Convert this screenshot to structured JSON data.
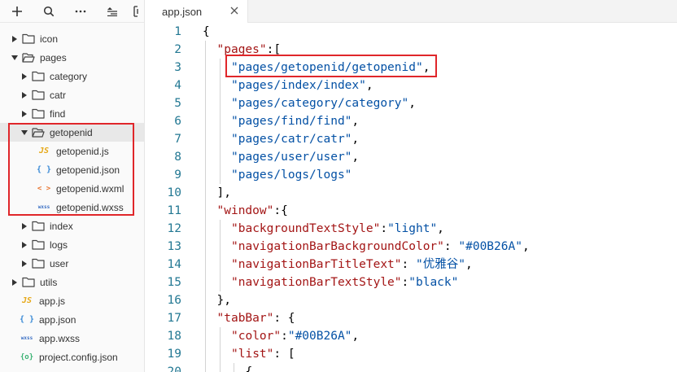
{
  "toolbar": {
    "buttons": [
      {
        "name": "add-icon"
      },
      {
        "name": "search-icon"
      },
      {
        "name": "more-icon"
      },
      {
        "name": "collapse-all-icon"
      },
      {
        "name": "split-icon"
      }
    ]
  },
  "tree": [
    {
      "label": "icon",
      "type": "folder",
      "depth": 0,
      "expanded": false
    },
    {
      "label": "pages",
      "type": "folder",
      "depth": 0,
      "expanded": true
    },
    {
      "label": "category",
      "type": "folder",
      "depth": 1,
      "expanded": false
    },
    {
      "label": "catr",
      "type": "folder",
      "depth": 1,
      "expanded": false
    },
    {
      "label": "find",
      "type": "folder",
      "depth": 1,
      "expanded": false
    },
    {
      "label": "getopenid",
      "type": "folder",
      "depth": 1,
      "expanded": true,
      "selected": true
    },
    {
      "label": "getopenid.js",
      "type": "js",
      "depth": 2
    },
    {
      "label": "getopenid.json",
      "type": "json",
      "depth": 2
    },
    {
      "label": "getopenid.wxml",
      "type": "wxml",
      "depth": 2
    },
    {
      "label": "getopenid.wxss",
      "type": "wxss",
      "depth": 2
    },
    {
      "label": "index",
      "type": "folder",
      "depth": 1,
      "expanded": false
    },
    {
      "label": "logs",
      "type": "folder",
      "depth": 1,
      "expanded": false
    },
    {
      "label": "user",
      "type": "folder",
      "depth": 1,
      "expanded": false
    },
    {
      "label": "utils",
      "type": "folder",
      "depth": 0,
      "expanded": false
    },
    {
      "label": "app.js",
      "type": "js",
      "depth": 0
    },
    {
      "label": "app.json",
      "type": "json",
      "depth": 0
    },
    {
      "label": "app.wxss",
      "type": "wxss",
      "depth": 0
    },
    {
      "label": "project.config.json",
      "type": "config",
      "depth": 0
    }
  ],
  "file_icons": {
    "js": "JS",
    "json": "{ }",
    "wxml": "< >",
    "wxss": "wxss",
    "config": "{o}"
  },
  "editor": {
    "tab_label": "app.json",
    "lines": [
      {
        "n": "1",
        "indent": 0,
        "tokens": [
          [
            "punc",
            "{"
          ]
        ]
      },
      {
        "n": "2",
        "indent": 1,
        "tokens": [
          [
            "key",
            "\"pages\""
          ],
          [
            "punc",
            ":["
          ]
        ]
      },
      {
        "n": "3",
        "indent": 2,
        "tokens": [
          [
            "str",
            "\"pages/getopenid/getopenid\""
          ],
          [
            "punc",
            ","
          ]
        ]
      },
      {
        "n": "4",
        "indent": 2,
        "tokens": [
          [
            "str",
            "\"pages/index/index\""
          ],
          [
            "punc",
            ","
          ]
        ]
      },
      {
        "n": "5",
        "indent": 2,
        "tokens": [
          [
            "str",
            "\"pages/category/category\""
          ],
          [
            "punc",
            ","
          ]
        ]
      },
      {
        "n": "6",
        "indent": 2,
        "tokens": [
          [
            "str",
            "\"pages/find/find\""
          ],
          [
            "punc",
            ","
          ]
        ]
      },
      {
        "n": "7",
        "indent": 2,
        "tokens": [
          [
            "str",
            "\"pages/catr/catr\""
          ],
          [
            "punc",
            ","
          ]
        ]
      },
      {
        "n": "8",
        "indent": 2,
        "tokens": [
          [
            "str",
            "\"pages/user/user\""
          ],
          [
            "punc",
            ","
          ]
        ]
      },
      {
        "n": "9",
        "indent": 2,
        "tokens": [
          [
            "str",
            "\"pages/logs/logs\""
          ]
        ]
      },
      {
        "n": "10",
        "indent": 1,
        "tokens": [
          [
            "punc",
            "],"
          ]
        ]
      },
      {
        "n": "11",
        "indent": 1,
        "tokens": [
          [
            "key",
            "\"window\""
          ],
          [
            "punc",
            ":{"
          ]
        ]
      },
      {
        "n": "12",
        "indent": 2,
        "tokens": [
          [
            "key",
            "\"backgroundTextStyle\""
          ],
          [
            "punc",
            ":"
          ],
          [
            "str",
            "\"light\""
          ],
          [
            "punc",
            ","
          ]
        ]
      },
      {
        "n": "13",
        "indent": 2,
        "tokens": [
          [
            "key",
            "\"navigationBarBackgroundColor\""
          ],
          [
            "punc",
            ": "
          ],
          [
            "str",
            "\"#00B26A\""
          ],
          [
            "punc",
            ","
          ]
        ]
      },
      {
        "n": "14",
        "indent": 2,
        "tokens": [
          [
            "key",
            "\"navigationBarTitleText\""
          ],
          [
            "punc",
            ": "
          ],
          [
            "str",
            "\"优雅谷\""
          ],
          [
            "punc",
            ","
          ]
        ]
      },
      {
        "n": "15",
        "indent": 2,
        "tokens": [
          [
            "key",
            "\"navigationBarTextStyle\""
          ],
          [
            "punc",
            ":"
          ],
          [
            "str",
            "\"black\""
          ]
        ]
      },
      {
        "n": "16",
        "indent": 1,
        "tokens": [
          [
            "punc",
            "},"
          ]
        ]
      },
      {
        "n": "17",
        "indent": 1,
        "tokens": [
          [
            "key",
            "\"tabBar\""
          ],
          [
            "punc",
            ": {"
          ]
        ]
      },
      {
        "n": "18",
        "indent": 2,
        "tokens": [
          [
            "key",
            "\"color\""
          ],
          [
            "punc",
            ":"
          ],
          [
            "str",
            "\"#00B26A\""
          ],
          [
            "punc",
            ","
          ]
        ]
      },
      {
        "n": "19",
        "indent": 2,
        "tokens": [
          [
            "key",
            "\"list\""
          ],
          [
            "punc",
            ": ["
          ]
        ]
      },
      {
        "n": "20",
        "indent": 3,
        "tokens": [
          [
            "punc",
            "{"
          ]
        ]
      }
    ]
  },
  "colors": {
    "highlight_border": "#e0262a",
    "line_number": "#237893",
    "json_key": "#a31515",
    "json_string": "#0451a5"
  }
}
